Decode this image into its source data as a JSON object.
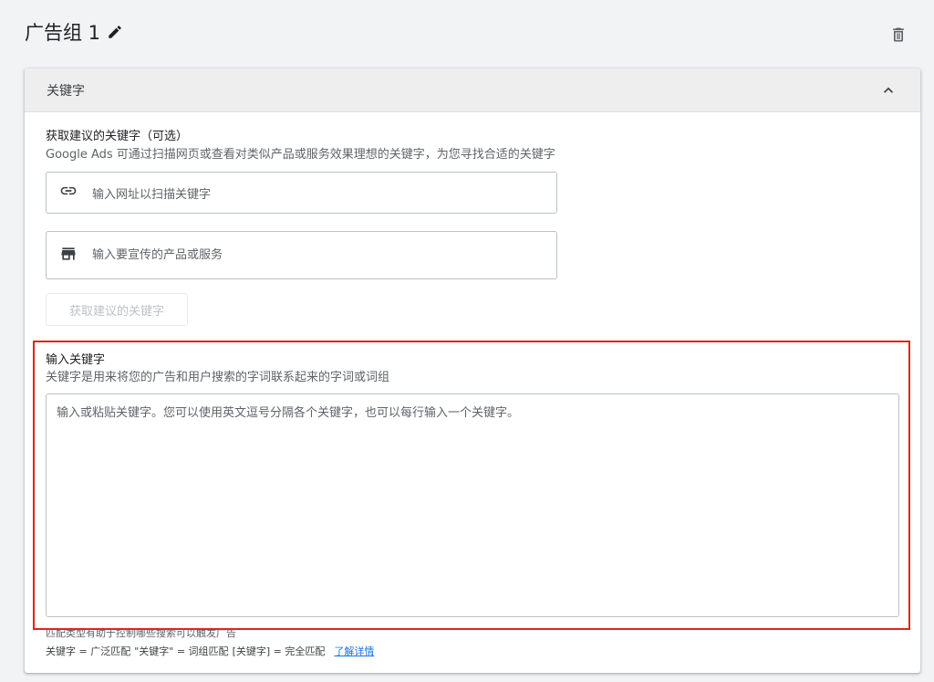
{
  "header": {
    "ad_group_title": "广告组 1",
    "edit_icon": "pencil-icon",
    "delete_icon": "trash-icon"
  },
  "card": {
    "header_label": "关键字",
    "collapse_icon": "chevron-up-icon",
    "suggest_section": {
      "title": "获取建议的关键字（可选）",
      "subtitle": "Google Ads 可通过扫描网页或查看对类似产品或服务效果理想的关键字，为您寻找合适的关键字",
      "url_input_placeholder": "输入网址以扫描关键字",
      "url_input_icon": "link-icon",
      "product_input_placeholder": "输入要宣传的产品或服务",
      "product_input_icon": "storefront-icon",
      "suggest_button_label": "获取建议的关键字"
    },
    "keywords_section": {
      "title": "输入关键字",
      "subtitle": "关键字是用来将您的广告和用户搜索的字词联系起来的字词或词组",
      "textarea_placeholder": "输入或粘贴关键字。您可以使用英文逗号分隔各个关键字，也可以每行输入一个关键字。",
      "match_type_note": "匹配类型有助于控制哪些搜索可以触发广告",
      "match_broad": "关键字 = 广泛匹配",
      "match_phrase": "\"关键字\" = 词组匹配",
      "match_exact": "[关键字] = 完全匹配",
      "learn_more": "了解详情"
    }
  },
  "colors": {
    "highlight": "#e0241b",
    "link": "#1a73e8"
  }
}
